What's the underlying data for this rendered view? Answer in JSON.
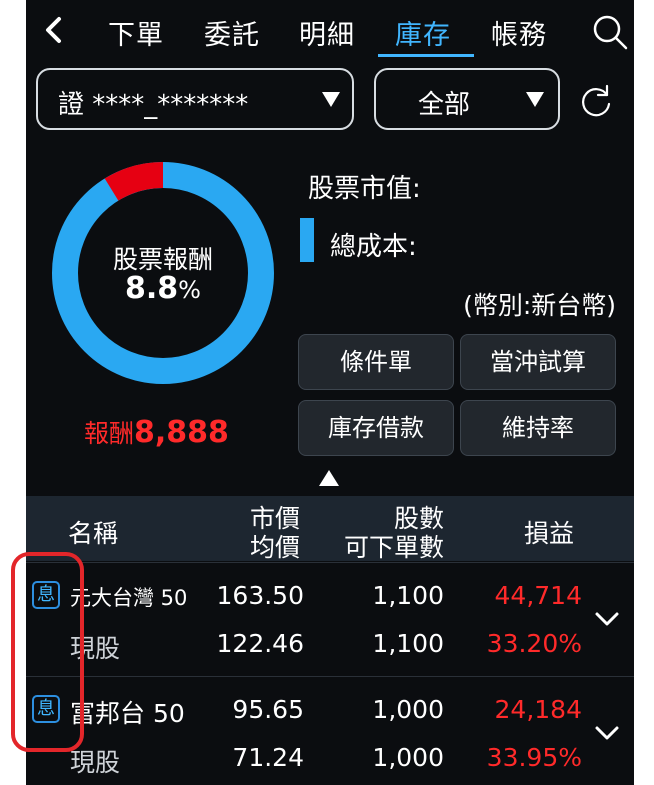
{
  "nav": {
    "tabs": [
      {
        "label": "下單",
        "active": false
      },
      {
        "label": "委託",
        "active": false
      },
      {
        "label": "明細",
        "active": false
      },
      {
        "label": "庫存",
        "active": true
      },
      {
        "label": "帳務",
        "active": false
      }
    ],
    "back_icon": "chevron-left-icon",
    "search_icon": "search-icon"
  },
  "filters": {
    "account": "證 ****_*******",
    "category": "全部",
    "refresh_icon": "refresh-icon"
  },
  "summary": {
    "donut_label": "股票報酬",
    "donut_pct_value": "8.8",
    "donut_pct_unit": "%",
    "return_fraction": 0.088,
    "reward_label": "報酬",
    "reward_value": "8,888",
    "market_value_label": "股票市值:",
    "total_cost_label": "總成本:",
    "currency_note": "(幣別:新台幣)"
  },
  "actions": {
    "conditional_order": "條件單",
    "daytrade_calc": "當沖試算",
    "stock_loan": "庫存借款",
    "maintenance_rate": "維持率"
  },
  "table": {
    "headers": {
      "name": "名稱",
      "price": "市價",
      "avg_price": "均價",
      "shares": "股數",
      "sellable": "可下單數",
      "pnl": "損益"
    },
    "rows": [
      {
        "badge": "息",
        "name": "元大台灣 50",
        "type": "現股",
        "price": "163.50",
        "avg_price": "122.46",
        "shares": "1,100",
        "sellable": "1,100",
        "pnl": "44,714",
        "pnl_pct": "33.20%"
      },
      {
        "badge": "息",
        "name": "富邦台 50",
        "type": "現股",
        "price": "95.65",
        "avg_price": "71.24",
        "shares": "1,000",
        "sellable": "1,000",
        "pnl": "24,184",
        "pnl_pct": "33.95%"
      }
    ]
  },
  "colors": {
    "accent": "#41b6ff",
    "donut_main": "#2aa8f2",
    "donut_return": "#e60012",
    "gain": "#ff2a2a",
    "highlight": "#e3262a"
  }
}
